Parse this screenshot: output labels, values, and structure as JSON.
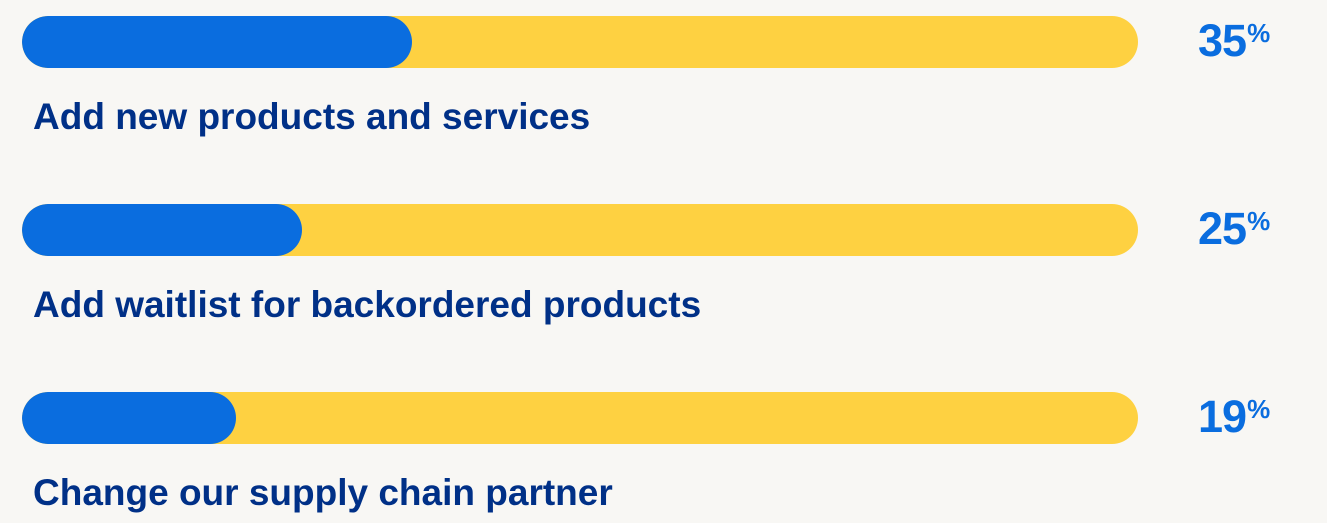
{
  "colors": {
    "background": "#f8f7f4",
    "track": "#fed141",
    "fill": "#0a6ddf",
    "value_text": "#0a6ddf",
    "label_text": "#003087"
  },
  "chart_data": {
    "type": "bar",
    "orientation": "horizontal",
    "categories": [
      "Add new products and services",
      "Add waitlist for backordered products",
      "Change our supply chain partner"
    ],
    "values": [
      35,
      25,
      19
    ],
    "value_labels": [
      "35",
      "25",
      "19"
    ],
    "unit_symbol": "%",
    "xlim": [
      0,
      100
    ],
    "grid": false,
    "legend": "none"
  }
}
